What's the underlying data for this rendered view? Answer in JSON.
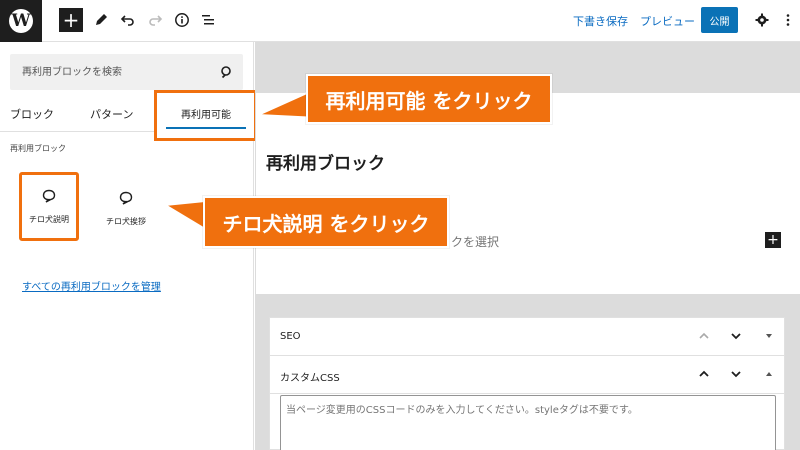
{
  "toolbar": {
    "draft_save": "下書き保存",
    "preview": "プレビュー",
    "publish": "公開"
  },
  "sidebar": {
    "search_placeholder": "再利用ブロックを検索",
    "tabs": [
      {
        "label": "ブロック"
      },
      {
        "label": "パターン"
      },
      {
        "label": "再利用可能"
      }
    ],
    "section_label": "再利用ブロック",
    "blocks": [
      {
        "label": "チロ犬説明"
      },
      {
        "label": "チロ犬挨拶"
      }
    ],
    "manage_link": "すべての再利用ブロックを管理"
  },
  "editor": {
    "card_title": "再利用ブロック",
    "card_sub": "クを選択"
  },
  "meta": {
    "seo_label": "SEO",
    "css_label": "カスタムCSS",
    "css_placeholder": "当ページ変更用のCSSコードのみを入力してください。styleタグは不要です。"
  },
  "callouts": {
    "reusable": "再利用可能 をクリック",
    "block": "チロ犬説明 をクリック"
  },
  "colors": {
    "accent_orange": "#f0700e",
    "wp_blue": "#0a72b6",
    "link_blue": "#0a6bc2",
    "dark": "#1e1e1e",
    "editor_bg": "#dcdcdc"
  }
}
